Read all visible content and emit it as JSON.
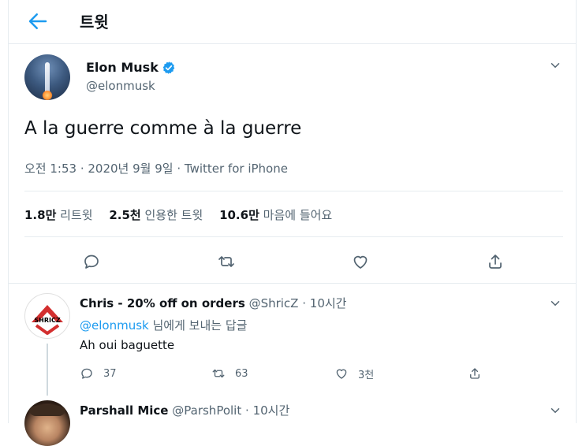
{
  "header": {
    "title": "트윗"
  },
  "tweet": {
    "author_name": "Elon Musk",
    "author_handle": "@elonmusk",
    "text": "A la guerre comme à la guerre",
    "timestamp": "오전 1:53 · 2020년 9월 9일",
    "meta_separator": "·",
    "source": "Twitter for iPhone",
    "stats": [
      {
        "value": "1.8만",
        "label": "리트윗"
      },
      {
        "value": "2.5천",
        "label": "인용한 트윗"
      },
      {
        "value": "10.6만",
        "label": "마음에 들어요"
      }
    ]
  },
  "replies": [
    {
      "name": "Chris - 20% off on orders",
      "handle": "@ShricZ",
      "time_sep": "·",
      "time": "10시간",
      "reply_to_handle": "@elonmusk",
      "reply_to_suffix": "님에게 보내는 답글",
      "text": "Ah oui baguette",
      "avatar_text": "SHRICZ",
      "reply_count": "37",
      "retweet_count": "63",
      "like_count": "3천"
    },
    {
      "name": "Parshall Mice",
      "handle": "@ParshPolit",
      "time_sep": "·",
      "time": "10시간"
    }
  ],
  "icons": {
    "back": "arrow-left-icon",
    "caret": "chevron-down-icon",
    "verified": "verified-badge-icon",
    "reply": "reply-icon",
    "retweet": "retweet-icon",
    "like": "heart-icon",
    "share": "share-icon"
  },
  "colors": {
    "accent": "#1d9bf0",
    "muted": "#536471",
    "border": "#e6ecf0"
  }
}
